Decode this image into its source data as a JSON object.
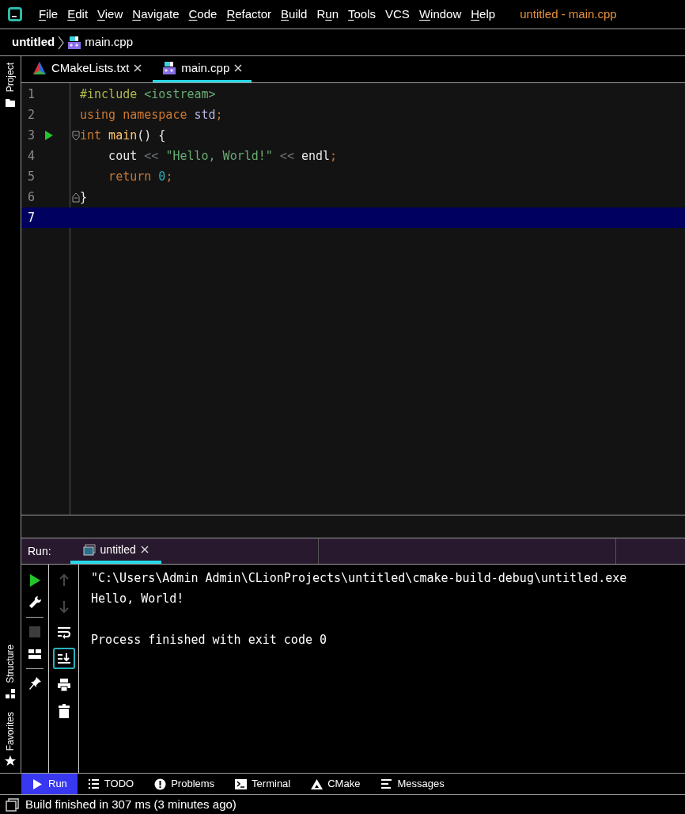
{
  "menu": [
    {
      "key": "F",
      "post": "ile"
    },
    {
      "key": "E",
      "post": "dit"
    },
    {
      "key": "V",
      "post": "iew"
    },
    {
      "key": "N",
      "post": "avigate"
    },
    {
      "key": "C",
      "post": "ode"
    },
    {
      "key": "R",
      "post": "efactor"
    },
    {
      "key": "B",
      "post": "uild"
    },
    {
      "pre": "R",
      "key": "u",
      "post": "n"
    },
    {
      "key": "T",
      "post": "ools"
    },
    {
      "post": "VCS"
    },
    {
      "key": "W",
      "post": "indow"
    },
    {
      "key": "H",
      "post": "elp"
    }
  ],
  "window": {
    "title": "untitled - main.cpp"
  },
  "breadcrumb": [
    {
      "label": "untitled",
      "kind": "project"
    },
    {
      "label": "main.cpp",
      "kind": "cpp"
    }
  ],
  "side_tools": [
    {
      "label": "Project",
      "kind": "folder"
    },
    {
      "label": "Structure",
      "kind": "structure"
    },
    {
      "label": "Favorites",
      "kind": "star"
    }
  ],
  "tabs": [
    {
      "label": "CMakeLists.txt",
      "kind": "cmake",
      "selected": false
    },
    {
      "label": "main.cpp",
      "kind": "cpp",
      "selected": true
    }
  ],
  "editor": {
    "lines": [
      {
        "number": "1",
        "current": false,
        "tokens": [
          {
            "kind": "directive",
            "text": "#include"
          },
          {
            "kind": "header",
            "text": " <iostream>"
          }
        ]
      },
      {
        "number": "2",
        "current": false,
        "tokens": [
          {
            "kind": "keyword",
            "text": "using"
          },
          {
            "kind": "keyword",
            "text": " namespace"
          },
          {
            "kind": "namespace",
            "text": " std"
          },
          {
            "kind": "punct",
            "text": ";"
          }
        ]
      },
      {
        "number": "3",
        "current": false,
        "run": true,
        "fold_start": true,
        "tokens": [
          {
            "kind": "keyword",
            "text": "int"
          },
          {
            "kind": "function",
            "text": " main"
          },
          {
            "kind": "plain",
            "text": "() {"
          }
        ]
      },
      {
        "number": "4",
        "current": false,
        "tokens": [
          {
            "kind": "plain",
            "text": "    cout"
          },
          {
            "kind": "operator",
            "text": " << "
          },
          {
            "kind": "string",
            "text": "\"Hello, World!\""
          },
          {
            "kind": "operator",
            "text": " << "
          },
          {
            "kind": "plain",
            "text": "endl"
          },
          {
            "kind": "punct",
            "text": ";"
          }
        ]
      },
      {
        "number": "5",
        "current": false,
        "tokens": [
          {
            "kind": "keyword",
            "text": "    return"
          },
          {
            "kind": "number",
            "text": " 0"
          },
          {
            "kind": "punct",
            "text": ";"
          }
        ]
      },
      {
        "number": "6",
        "current": false,
        "fold_end": true,
        "tokens": [
          {
            "kind": "plain",
            "text": "}"
          }
        ]
      },
      {
        "number": "7",
        "current": true
      }
    ]
  },
  "run_panel": {
    "label": "Run:",
    "tabs": [
      {
        "label": "untitled",
        "selected": true
      }
    ],
    "toolbar": [
      {
        "kind": "rerun",
        "disabled": false
      },
      {
        "kind": "wrench",
        "disabled": false
      },
      {
        "kind": "stop",
        "disabled": true
      },
      {
        "kind": "layout",
        "disabled": false
      },
      {
        "kind": "pin",
        "disabled": false
      }
    ],
    "toolbar_2": [
      {
        "kind": "up",
        "disabled": true,
        "selected": false
      },
      {
        "kind": "down",
        "disabled": true,
        "selected": false
      },
      {
        "kind": "wrap",
        "disabled": false,
        "selected": false
      },
      {
        "kind": "scroll",
        "disabled": false,
        "selected": true
      },
      {
        "kind": "print",
        "disabled": false,
        "selected": false
      },
      {
        "kind": "trash",
        "disabled": false,
        "selected": false
      }
    ],
    "output_blocks": [
      [
        "\"C:\\Users\\Admin Admin\\CLionProjects\\untitled\\cmake-build-debug\\untitled.exe",
        "Hello, World!"
      ],
      [
        "Process finished with exit code 0"
      ]
    ]
  },
  "tool_buttons": [
    {
      "label": "Run",
      "kind": "run",
      "selected": true
    },
    {
      "label": "TODO",
      "kind": "todo",
      "selected": false
    },
    {
      "label": "Problems",
      "kind": "problems",
      "selected": false
    },
    {
      "label": "Terminal",
      "kind": "terminal",
      "selected": false
    },
    {
      "label": "CMake",
      "kind": "cmake",
      "selected": false
    },
    {
      "label": "Messages",
      "kind": "messages",
      "selected": false
    }
  ],
  "status_bar": {
    "text": "Build finished in 307 ms (3 minutes ago)"
  }
}
